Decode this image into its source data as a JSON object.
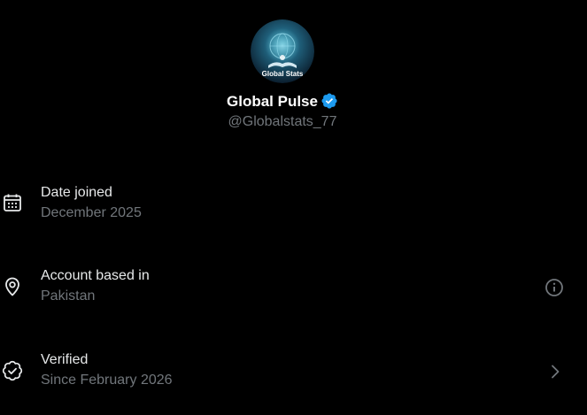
{
  "profile": {
    "display_name": "Global Pulse",
    "handle": "@Globalstats_77",
    "avatar_text": "Global Stats",
    "verified_badge_color": "#1d9bf0"
  },
  "rows": {
    "date_joined": {
      "title": "Date joined",
      "value": "December 2025",
      "icon": "calendar-icon"
    },
    "account_based": {
      "title": "Account based in",
      "value": "Pakistan",
      "icon": "location-pin-icon",
      "action_icon": "info-icon"
    },
    "verified": {
      "title": "Verified",
      "value": "Since February 2026",
      "icon": "verified-check-icon",
      "action_icon": "chevron-right-icon"
    }
  },
  "colors": {
    "background": "#000000",
    "primary_text": "#e7e9ea",
    "secondary_text": "#71767b",
    "accent": "#1d9bf0"
  }
}
